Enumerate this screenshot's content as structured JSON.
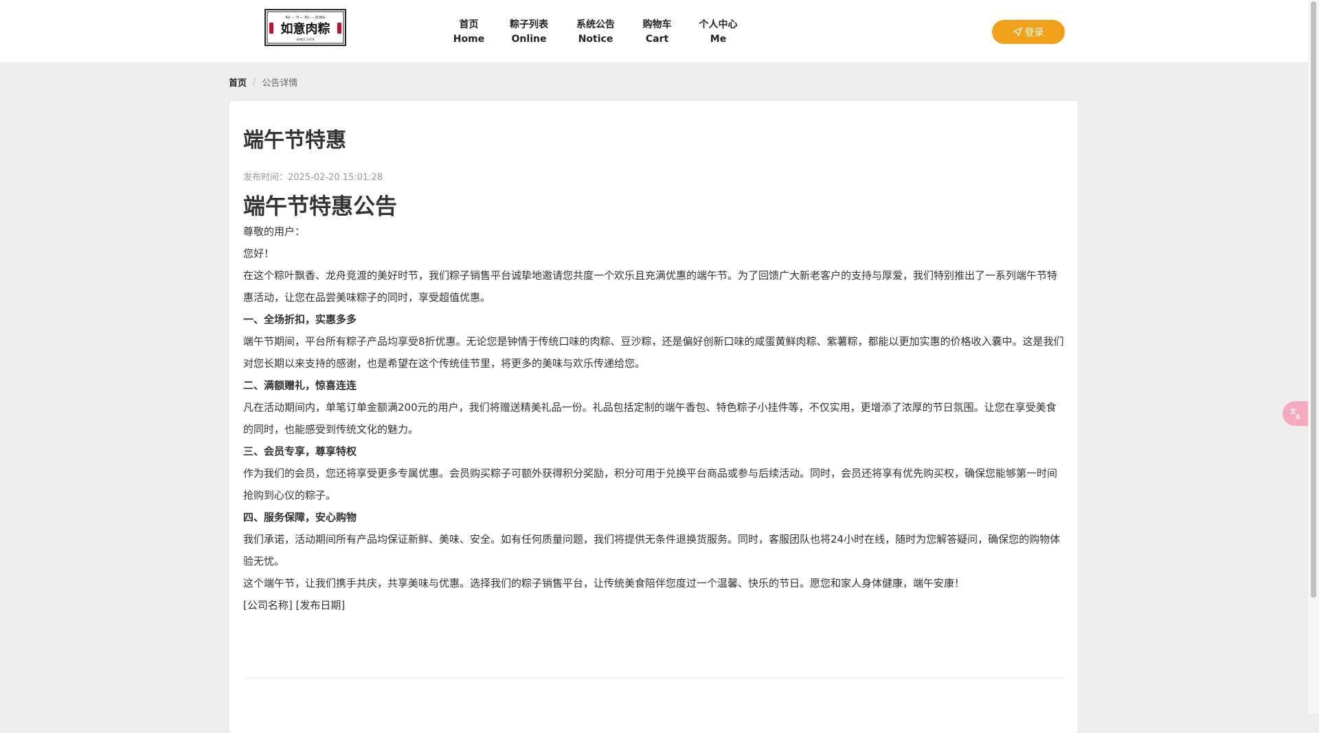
{
  "header": {
    "logo_text": "如意肉粽",
    "logo_sub_top": "RU — YI — RU — ZONG",
    "logo_sub_bottom": "SINCE 1978",
    "nav": [
      {
        "cn": "首页",
        "en": "Home"
      },
      {
        "cn": "粽子列表",
        "en": "Online"
      },
      {
        "cn": "系统公告",
        "en": "Notice"
      },
      {
        "cn": "购物车",
        "en": "Cart"
      },
      {
        "cn": "个人中心",
        "en": "Me"
      }
    ],
    "login_label": "登录"
  },
  "breadcrumb": {
    "home": "首页",
    "separator": "/",
    "current": "公告详情"
  },
  "notice": {
    "title": "端午节特惠",
    "publish_time": "发布时间：2025-02-20 15:01:28",
    "heading": "端午节特惠公告",
    "paragraphs": [
      {
        "text": "尊敬的用户：",
        "bold": false
      },
      {
        "text": "您好！",
        "bold": false
      },
      {
        "text": "在这个粽叶飘香、龙舟竞渡的美好时节，我们粽子销售平台诚挚地邀请您共度一个欢乐且充满优惠的端午节。为了回馈广大新老客户的支持与厚爱，我们特别推出了一系列端午节特惠活动，让您在品尝美味粽子的同时，享受超值优惠。",
        "bold": false
      },
      {
        "text": "一、全场折扣，实惠多多",
        "bold": true
      },
      {
        "text": "端午节期间，平台所有粽子产品均享受8折优惠。无论您是钟情于传统口味的肉粽、豆沙粽，还是偏好创新口味的咸蛋黄鲜肉粽、紫薯粽，都能以更加实惠的价格收入囊中。这是我们对您长期以来支持的感谢，也是希望在这个传统佳节里，将更多的美味与欢乐传递给您。",
        "bold": false
      },
      {
        "text": "二、满额赠礼，惊喜连连",
        "bold": true
      },
      {
        "text": "凡在活动期间内，单笔订单金额满200元的用户，我们将赠送精美礼品一份。礼品包括定制的端午香包、特色粽子小挂件等，不仅实用，更增添了浓厚的节日氛围。让您在享受美食的同时，也能感受到传统文化的魅力。",
        "bold": false
      },
      {
        "text": "三、会员专享，尊享特权",
        "bold": true
      },
      {
        "text": "作为我们的会员，您还将享受更多专属优惠。会员购买粽子可额外获得积分奖励，积分可用于兑换平台商品或参与后续活动。同时，会员还将享有优先购买权，确保您能够第一时间抢购到心仪的粽子。",
        "bold": false
      },
      {
        "text": "四、服务保障，安心购物",
        "bold": true
      },
      {
        "text": "我们承诺，活动期间所有产品均保证新鲜、美味、安全。如有任何质量问题，我们将提供无条件退换货服务。同时，客服团队也将24小时在线，随时为您解答疑问，确保您的购物体验无忧。",
        "bold": false
      },
      {
        "text": "这个端午节，让我们携手共庆，共享美味与优惠。选择我们的粽子销售平台，让传统美食陪伴您度过一个温馨、快乐的节日。愿您和家人身体健康，端午安康！",
        "bold": false
      },
      {
        "text": "[公司名称] [发布日期]",
        "bold": false
      }
    ]
  },
  "colors": {
    "accent": "#f0a119",
    "page_bg": "#eeeeee",
    "card_bg": "#ffffff",
    "translate_float": "#f7a9c0"
  },
  "icons": {
    "login": "send-icon",
    "translate": "translate-icon"
  }
}
